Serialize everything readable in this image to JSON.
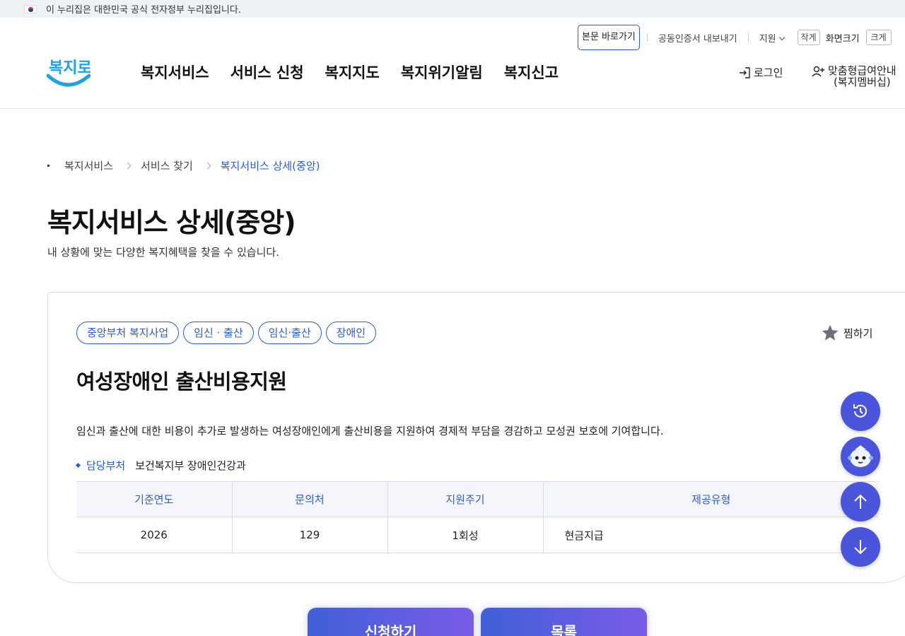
{
  "gov_banner": {
    "text": "이 누리집은 대한민국 공식 전자정부 누리집입니다."
  },
  "util_nav": {
    "skip": "본문 바로가기",
    "cert": "공동인증서 내보내기",
    "support": "지원",
    "font_small": "작게",
    "font_label": "화면크기",
    "font_large": "크게"
  },
  "logo": {
    "text": "복지로"
  },
  "gnb": [
    "복지서비스",
    "서비스 신청",
    "복지지도",
    "복지위기알림",
    "복지신고"
  ],
  "header_actions": {
    "login": "로그인",
    "member_line1": "맞춤형급여안내",
    "member_line2": "(복지멤버십)"
  },
  "breadcrumb": [
    "복지서비스",
    "서비스 찾기",
    "복지서비스 상세(중앙)"
  ],
  "page": {
    "title": "복지서비스 상세(중앙)",
    "subtitle": "내 상황에 맞는 다양한 복지혜택을 찾을 수 있습니다."
  },
  "service": {
    "tags": [
      "중앙부처 복지사업",
      "임신 · 출산",
      "임신·출산",
      "장애인"
    ],
    "favorite": "찜하기",
    "title": "여성장애인 출산비용지원",
    "description": "임신과 출산에 대한 비용이 추가로 발생하는 여성장애인에게 출산비용을 지원하여 경제적 부담을 경감하고 모성권 보호에 기여합니다.",
    "dept_label": "담당부처",
    "dept_value": "보건복지부 장애인건강과",
    "table": {
      "headers": [
        "기준연도",
        "문의처",
        "지원주기",
        "제공유형"
      ],
      "row": [
        "2026",
        "129",
        "1회성",
        "현금지급"
      ]
    }
  },
  "actions": {
    "apply": "신청하기",
    "list": "목록"
  },
  "colors": {
    "accent": "#2d5bd0",
    "float_button": "#4a55dc",
    "logo_blue": "#1fa3e0"
  },
  "floating_icons": [
    "history-icon",
    "chatbot-icon",
    "scroll-up-icon",
    "scroll-down-icon"
  ]
}
